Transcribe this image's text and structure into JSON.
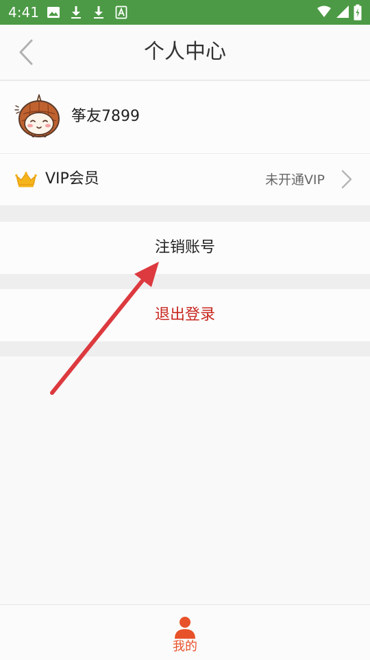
{
  "status_bar": {
    "time": "4:41",
    "left_icons": [
      "image-icon",
      "download-icon",
      "download-icon",
      "text-a-icon"
    ],
    "right_icons": [
      "wifi-icon",
      "signal-icon",
      "battery-icon"
    ],
    "background": "#4c9a45"
  },
  "header": {
    "back_icon": "chevron-left-icon",
    "title": "个人中心"
  },
  "profile": {
    "avatar_icon": "cartoon-avatar",
    "username": "筝友7899"
  },
  "vip": {
    "icon": "crown-icon",
    "label": "VIP会员",
    "status": "未开通VIP",
    "chevron_icon": "chevron-right-icon",
    "crown_color": "#f5b41c"
  },
  "actions": {
    "cancel_account": "注销账号",
    "logout": "退出登录",
    "logout_color": "#c8271f"
  },
  "bottom_nav": {
    "active_tab": {
      "icon": "person-icon",
      "label": "我的",
      "color": "#e8522a"
    }
  },
  "annotation": {
    "arrow_color": "#dc3a3f"
  }
}
